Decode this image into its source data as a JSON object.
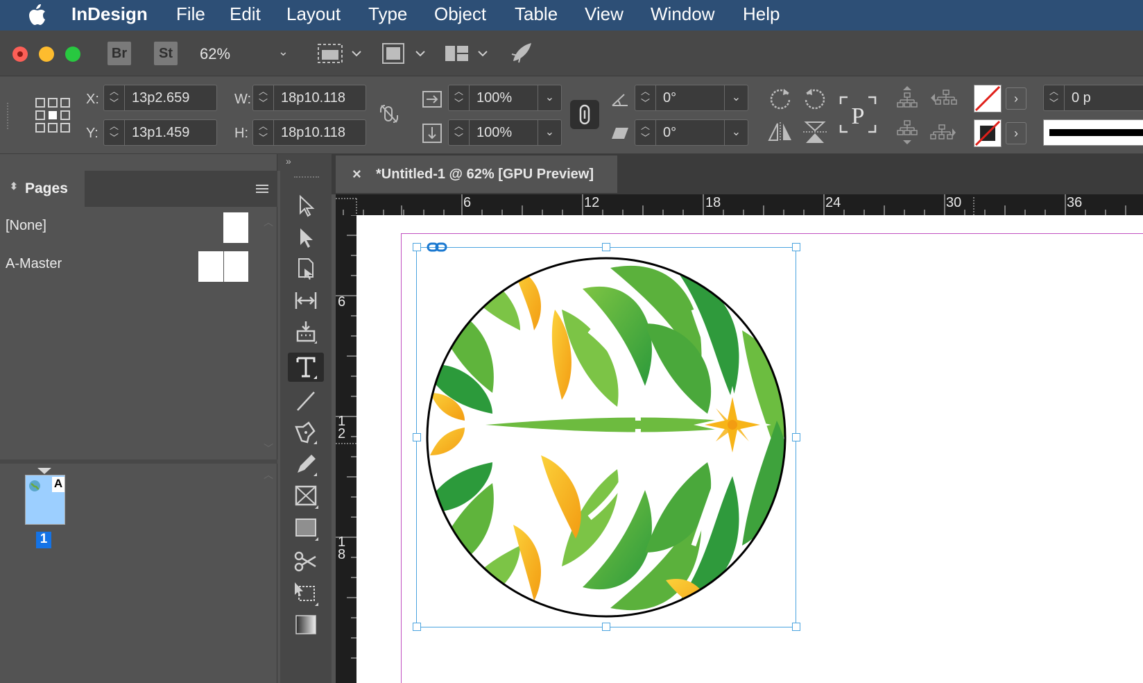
{
  "menubar": {
    "app_name": "InDesign",
    "items": [
      "File",
      "Edit",
      "Layout",
      "Type",
      "Object",
      "Table",
      "View",
      "Window",
      "Help"
    ]
  },
  "appbar": {
    "bridge": "Br",
    "stock": "St",
    "zoom": "62%"
  },
  "control": {
    "x_label": "X:",
    "x_value": "13p2.659",
    "y_label": "Y:",
    "y_value": "13p1.459",
    "w_label": "W:",
    "w_value": "18p10.118",
    "h_label": "H:",
    "h_value": "18p10.118",
    "scale_x": "100%",
    "scale_y": "100%",
    "rotation": "0°",
    "shear": "0°",
    "stroke_weight_partial": "0 p"
  },
  "pages_panel": {
    "title": "Pages",
    "masters": [
      {
        "name": "[None]"
      },
      {
        "name": "A-Master"
      }
    ],
    "page_number": "1",
    "page_master_prefix": "A"
  },
  "document": {
    "tab_title": "*Untitled-1 @ 62% [GPU Preview]",
    "ruler_h": [
      "6",
      "12",
      "18",
      "24",
      "30",
      "36"
    ],
    "ruler_v": [
      [
        "6"
      ],
      [
        "1",
        "2"
      ],
      [
        "1",
        "8"
      ]
    ]
  },
  "colors": {
    "menubar": "#2d4f76",
    "selection": "#4aa3df",
    "margin": "#c04fc0",
    "green": "#5cb43a",
    "yellow": "#f7b418"
  }
}
